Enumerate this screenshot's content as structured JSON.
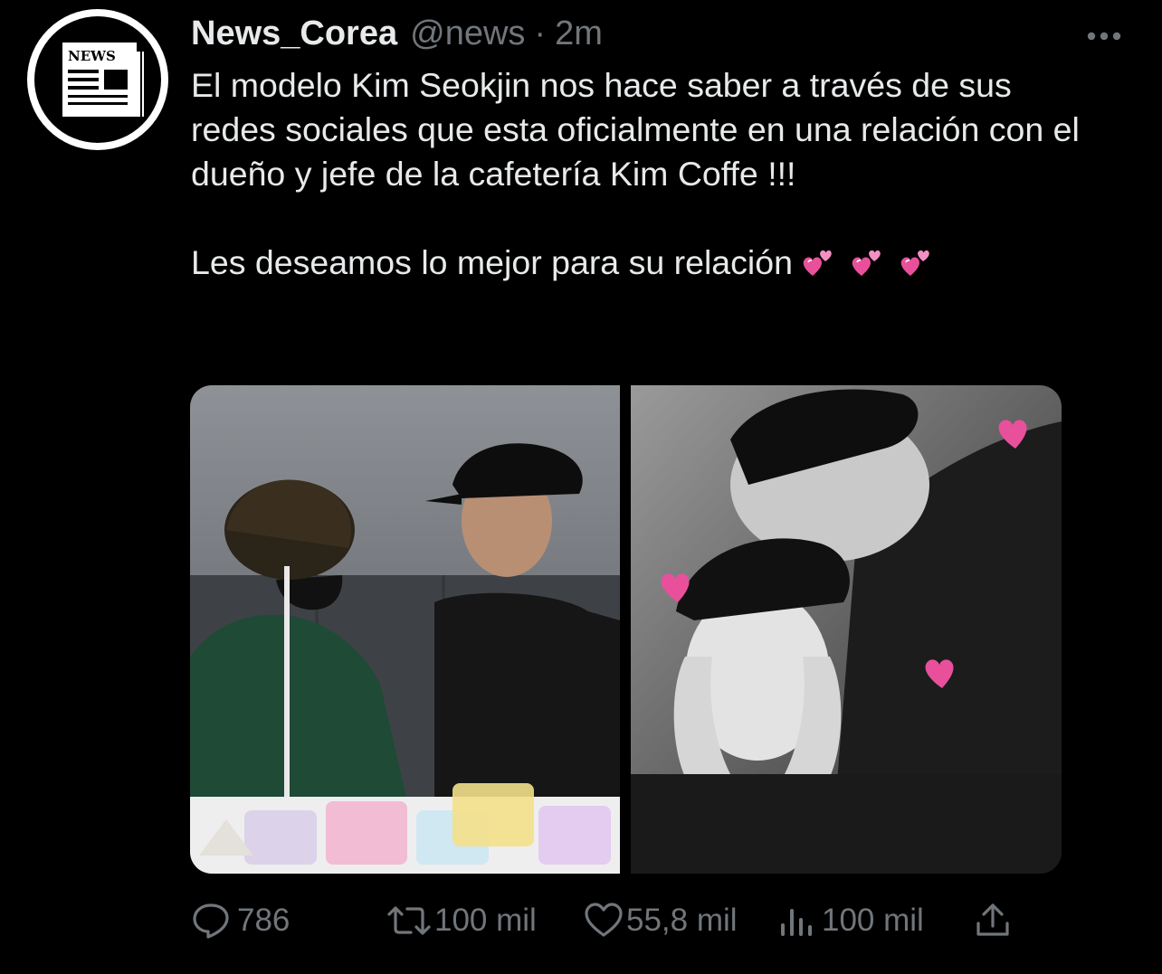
{
  "tweet": {
    "author": {
      "name": "News_Corea",
      "handle": "@news",
      "avatar_text": "NEWS"
    },
    "separator": "·",
    "time": "2m",
    "paragraphs": [
      "El modelo Kim Seokjin nos hace saber a través de sus redes sociales que esta oficialmente en una relación con el dueño y jefe de la cafetería Kim Coffe !!!",
      "Les deseamos lo mejor para su relación"
    ],
    "emoji": [
      "two-hearts-emoji",
      "two-hearts-emoji",
      "two-hearts-emoji"
    ],
    "media": [
      {
        "name": "photo-two-men-seated"
      },
      {
        "name": "photo-black-and-white-pair"
      }
    ]
  },
  "actions": {
    "reply": {
      "icon": "reply-icon",
      "count": "786"
    },
    "retweet": {
      "icon": "retweet-icon",
      "count": "100 mil"
    },
    "like": {
      "icon": "heart-icon",
      "count": "55,8 mil"
    },
    "views": {
      "icon": "views-icon",
      "count": "100 mil"
    },
    "share": {
      "icon": "share-icon"
    }
  },
  "colors": {
    "background": "#000000",
    "text": "#e7e9ea",
    "muted": "#71767b",
    "accent_pink": "#e8509b"
  }
}
